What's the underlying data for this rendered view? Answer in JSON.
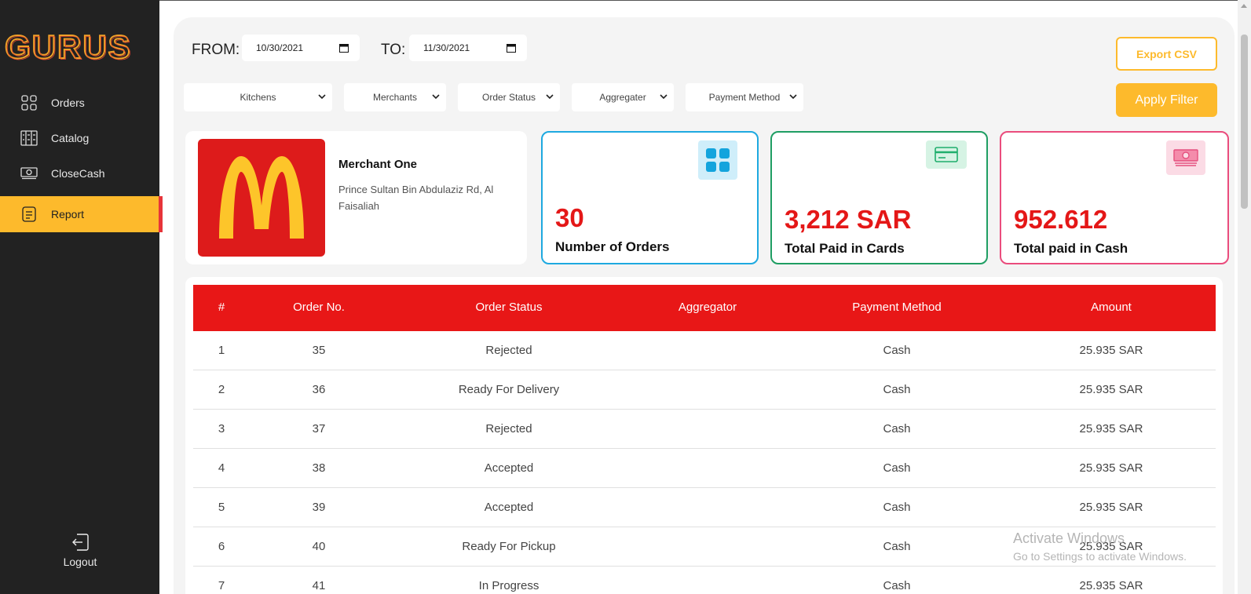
{
  "sidebar": {
    "logo_text": "GURUS",
    "items": [
      {
        "label": "Orders",
        "icon": "grid-icon"
      },
      {
        "label": "Catalog",
        "icon": "catalog-icon"
      },
      {
        "label": "CloseCash",
        "icon": "cash-icon"
      },
      {
        "label": "Report",
        "icon": "report-icon",
        "active": true
      }
    ],
    "logout_label": "Logout"
  },
  "filters": {
    "from_label": "FROM:",
    "from_value": "10/30/2021",
    "to_label": "TO:",
    "to_value": "11/30/2021",
    "selects": [
      "Kitchens",
      "Merchants",
      "Order Status",
      "Aggregater",
      "Payment Method"
    ],
    "export_label": "Export CSV",
    "apply_label": "Apply Filter"
  },
  "merchant": {
    "name": "Merchant One",
    "address": "Prince Sultan Bin Abdulaziz Rd, Al Faisaliah"
  },
  "stats": {
    "orders": {
      "value": "30",
      "caption": "Number of Orders",
      "color": "#1ea9e0"
    },
    "cards": {
      "value": "3,212 SAR",
      "caption": "Total Paid in Cards",
      "color": "#1f9e63"
    },
    "cash": {
      "value": "952.612",
      "caption": "Total paid in Cash",
      "color": "#ea4c7d"
    }
  },
  "table": {
    "headers": [
      "#",
      "Order No.",
      "Order Status",
      "Aggregator",
      "Payment Method",
      "Amount"
    ],
    "rows": [
      [
        "1",
        "35",
        "Rejected",
        "",
        "Cash",
        "25.935 SAR"
      ],
      [
        "2",
        "36",
        "Ready For Delivery",
        "",
        "Cash",
        "25.935 SAR"
      ],
      [
        "3",
        "37",
        "Rejected",
        "",
        "Cash",
        "25.935 SAR"
      ],
      [
        "4",
        "38",
        "Accepted",
        "",
        "Cash",
        "25.935 SAR"
      ],
      [
        "5",
        "39",
        "Accepted",
        "",
        "Cash",
        "25.935 SAR"
      ],
      [
        "6",
        "40",
        "Ready For Pickup",
        "",
        "Cash",
        "25.935 SAR"
      ],
      [
        "7",
        "41",
        "In Progress",
        "",
        "Cash",
        "25.935 SAR"
      ]
    ]
  },
  "watermark": {
    "line1": "Activate Windows",
    "line2": "Go to Settings to activate Windows."
  },
  "colors": {
    "accent": "#fdba2c",
    "header_red": "#e81717",
    "sidebar_bg": "#222222"
  }
}
